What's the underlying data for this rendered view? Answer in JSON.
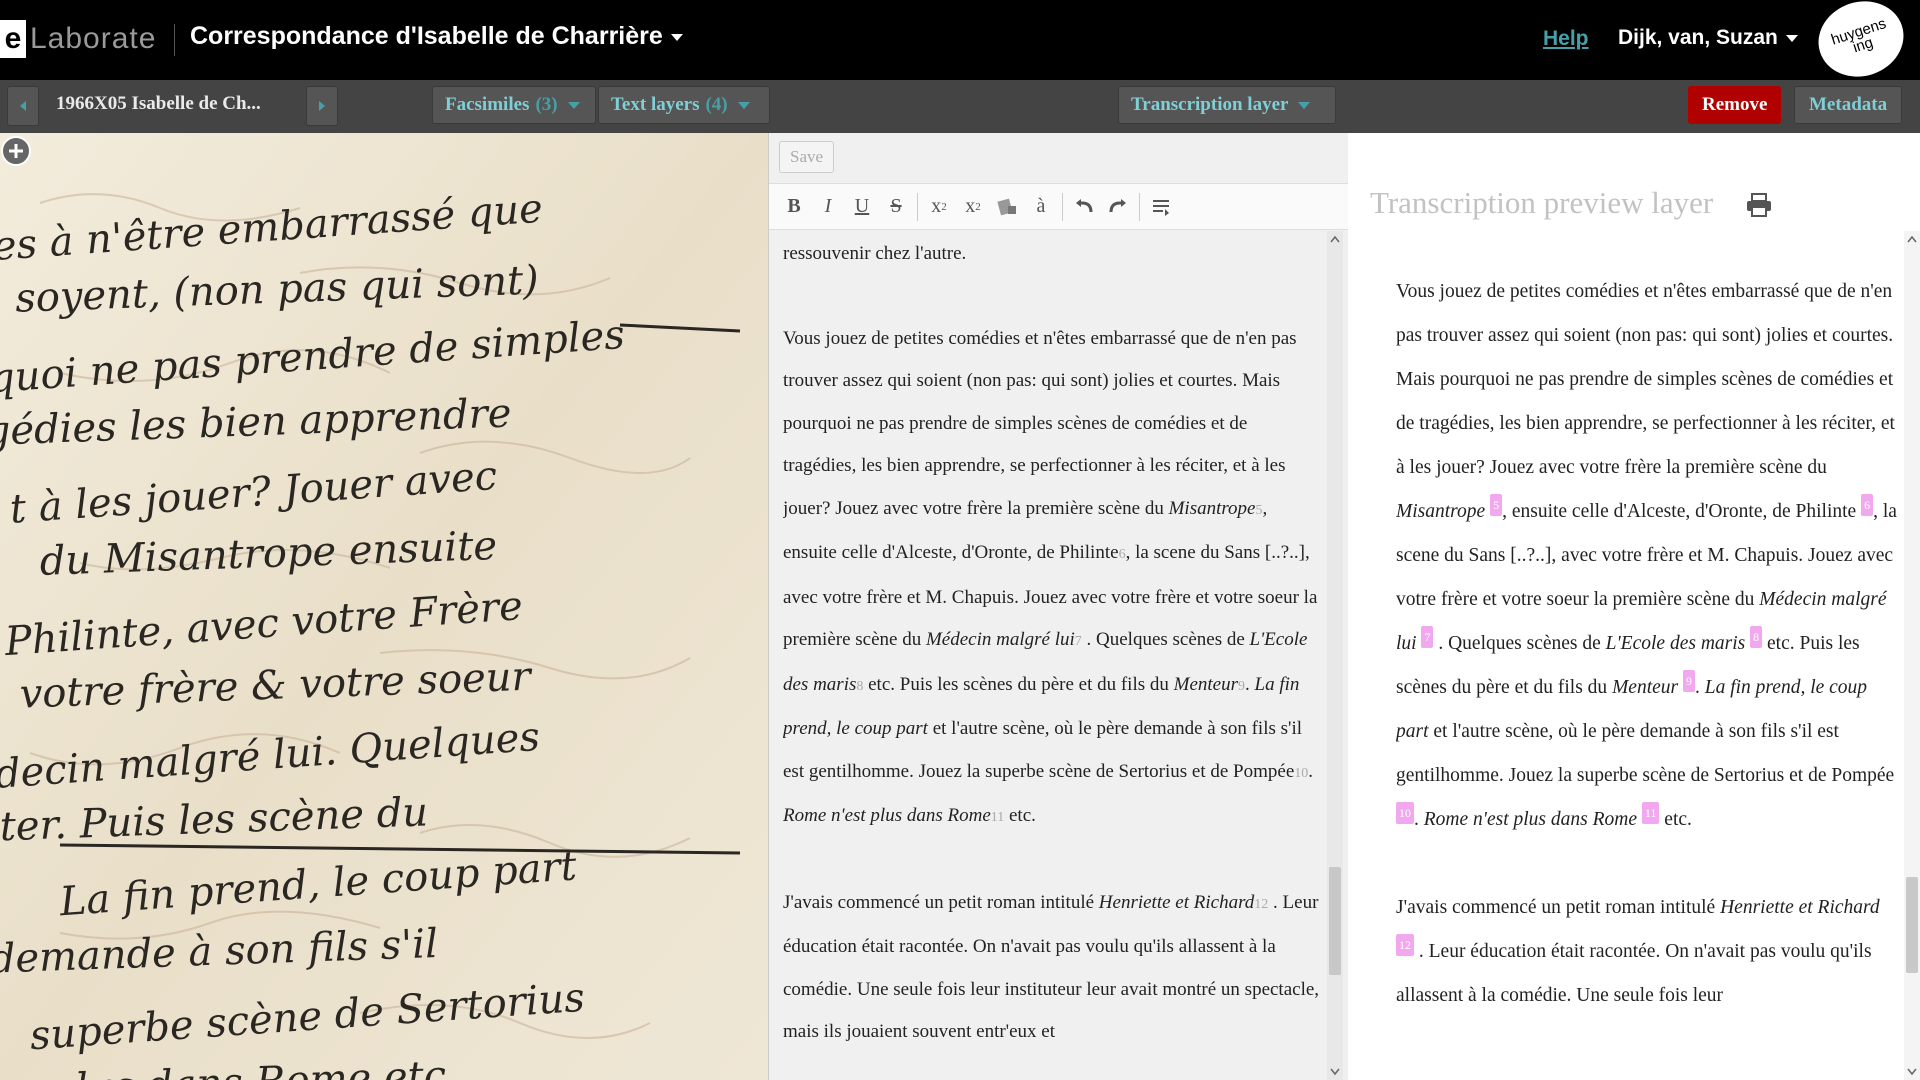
{
  "topbar": {
    "logo_e": "e",
    "logo_rest": "Laborate",
    "project_title": "Correspondance d'Isabelle de Charrière",
    "help": "Help",
    "user": "Dijk, van, Suzan",
    "huygens_line1": "huygens",
    "huygens_line2": "ing"
  },
  "subbar": {
    "entry_name": "1966X05 Isabelle de Ch...",
    "facsimiles_label": "Facsimiles",
    "facsimiles_count": "(3)",
    "textlayers_label": "Text layers",
    "textlayers_count": "(4)",
    "transcription_layer": "Transcription layer",
    "remove": "Remove",
    "metadata": "Metadata"
  },
  "facsimile": {
    "lines": [
      "ies à n'être embarrassé que",
      "i soyent, (non pas qui sont)",
      "rquoi ne pas prendre de simples",
      "gédies les bien apprendre",
      "t à les jouer? Jouer avec",
      "du Misantrope ensuite",
      "Philinte, avec votre Frère",
      "votre frère & votre soeur",
      "decin malgré lui. Quelques",
      "ter. Puis les scène du",
      "La fin prend, le coup part",
      "demande à son fils s'il",
      "superbe scène de Sertorius",
      "plus dans Rome etc"
    ]
  },
  "editor": {
    "save": "Save",
    "toolbar": {
      "bold": "B",
      "italic": "I",
      "underline": "U",
      "strike": "S",
      "sub": "x",
      "sub_mark": "2",
      "sup": "x",
      "sup_mark": "2",
      "accent": "à"
    },
    "p0": "ressouvenir chez l'autre.",
    "p1": {
      "t1": "Vous jouez de petites comédies et n'êtes embarrassé que de n'en pas trouver assez qui soient (non pas: qui sont) jolies et courtes. Mais pourquoi ne pas prendre de simples scènes de comédies et de tragédies, les bien apprendre, se perfectionner à les réciter, et à les jouer? Jouez avec votre frère la première scène du ",
      "i1": "Misantrope",
      "f5": "5",
      "t2": ", ensuite celle d'Alceste, d'Oronte, de Philinte",
      "f6": "6",
      "t3": ", la scene du Sans [..?..], avec votre frère et M. Chapuis. Jouez avec votre frère et votre soeur la première scène du ",
      "i2": "Médecin malgré lui",
      "f7": "7",
      "t4": " . Quelques scènes de ",
      "i3": "L'Ecole des maris",
      "f8": "8",
      "t5": " etc. Puis les scènes du père et du fils du ",
      "i4": "Menteur",
      "f9": "9",
      "t6": ". ",
      "i5": "La fin prend, le coup part",
      "t7": " et l'autre scène, où le père demande à son fils s'il est gentilhomme. Jouez la superbe scène de Sertorius et de Pompée",
      "f10": "10",
      "t8": ". ",
      "i6": "Rome n'est plus dans Rome",
      "f11": "11",
      "t9": " etc."
    },
    "p2": {
      "t1": "J'avais commencé un petit roman intitulé ",
      "i1": "Henriette et Richard",
      "f12": "12",
      "t2": " . Leur éducation était racontée. On n'avait pas voulu qu'ils allassent à la comédie. Une seule fois leur instituteur leur avait montré un spectacle, mais ils jouaient souvent entr'eux et"
    }
  },
  "preview": {
    "title": "Transcription preview layer",
    "p1": {
      "t1": "Vous jouez de petites comédies et n'êtes embarrassé que de n'en pas trouver assez qui soient (non pas: qui sont) jolies et courtes. Mais pourquoi ne pas prendre de simples scènes de comédies et de tragédies, les bien apprendre, se perfectionner à les réciter, et à les jouer? Jouez avec votre frère la première scène du ",
      "i1": "Misantrope",
      "m5": "5",
      "t2": ", ensuite celle d'Alceste, d'Oronte, de Philinte ",
      "m6": "6",
      "t3": ", la scene du Sans [..?..], avec votre frère et M. Chapuis. Jouez avec votre frère et votre soeur la première scène du ",
      "i2": "Médecin malgré lui",
      "m7": "7",
      "t4": " . Quelques scènes de ",
      "i3": "L'Ecole des maris",
      "m8": "8",
      "t5": " etc. Puis les scènes du père et du fils du ",
      "i4": "Menteur",
      "m9": "9",
      "t6": ". ",
      "i5": "La fin prend, le coup part",
      "t7": " et l'autre scène, où le père demande à son fils s'il est gentilhomme. Jouez la superbe scène de Sertorius et de Pompée ",
      "m10": "10",
      "t8": ". ",
      "i6": "Rome n'est plus dans Rome",
      "m11": "11",
      "t9": " etc."
    },
    "p2": {
      "t1": "J'avais commencé un petit roman intitulé ",
      "i1": "Henriette et Richard",
      "m12": "12",
      "t2": " . Leur éducation était racontée. On n'avait pas voulu qu'ils allassent à la comédie. Une seule fois leur"
    }
  },
  "colors": {
    "accent": "#47a0a8",
    "remove": "#b00000",
    "marker": "#f2a8ee",
    "topbar": "#000000",
    "subbar": "#444444"
  },
  "icons": [
    "chevron-left-icon",
    "chevron-right-icon",
    "caret-down-icon",
    "zoom-plus-icon",
    "print-icon",
    "undo-icon",
    "redo-icon",
    "clear-format-icon",
    "insert-icon"
  ]
}
